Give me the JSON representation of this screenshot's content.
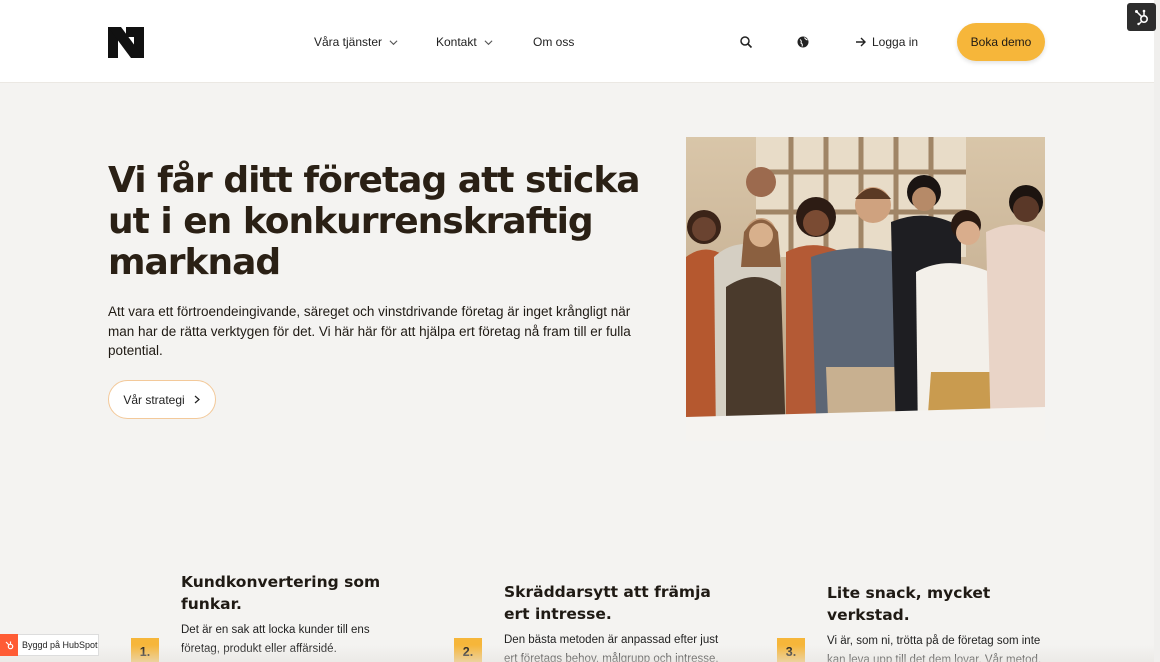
{
  "header": {
    "logo_name": "company-logo",
    "nav": [
      {
        "label": "Våra tjänster",
        "has_dropdown": true
      },
      {
        "label": "Kontakt",
        "has_dropdown": true
      },
      {
        "label": "Om oss",
        "has_dropdown": false
      }
    ],
    "login_label": "Logga in",
    "cta_label": "Boka demo"
  },
  "hero": {
    "title": "Vi får ditt företag att sticka ut i en konkurrenskraftig marknad",
    "text": "Att vara ett förtroendeingivande, säreget och vinstdrivande företag är inget krångligt när man har de rätta verktygen för det. Vi här här för att hjälpa ert företag nå fram till er fulla potential.",
    "button_label": "Vår strategi"
  },
  "features": [
    {
      "number": "1.",
      "title": "Kundkonvertering som funkar.",
      "text": "Det är en sak att locka kunder till ens företag, produkt eller affärsidé. Problemet"
    },
    {
      "number": "2.",
      "title": "Skräddarsytt att främja ert intresse.",
      "text": "Den bästa metoden är anpassad efter just ert företags behov, målgrupp och intresse."
    },
    {
      "number": "3.",
      "title": "Lite snack, mycket verkstad.",
      "text": "Vi är, som ni, trötta på de företag som inte kan leva upp till det dem lovar. Vår metod, strategi och metodik är utformad just för att"
    }
  ],
  "hubspot_badge": "Byggd på HubSpot",
  "colors": {
    "accent": "#f6b63a",
    "background": "#f4f3f1",
    "text": "#1f1a14",
    "button_border": "#f3c99a"
  }
}
